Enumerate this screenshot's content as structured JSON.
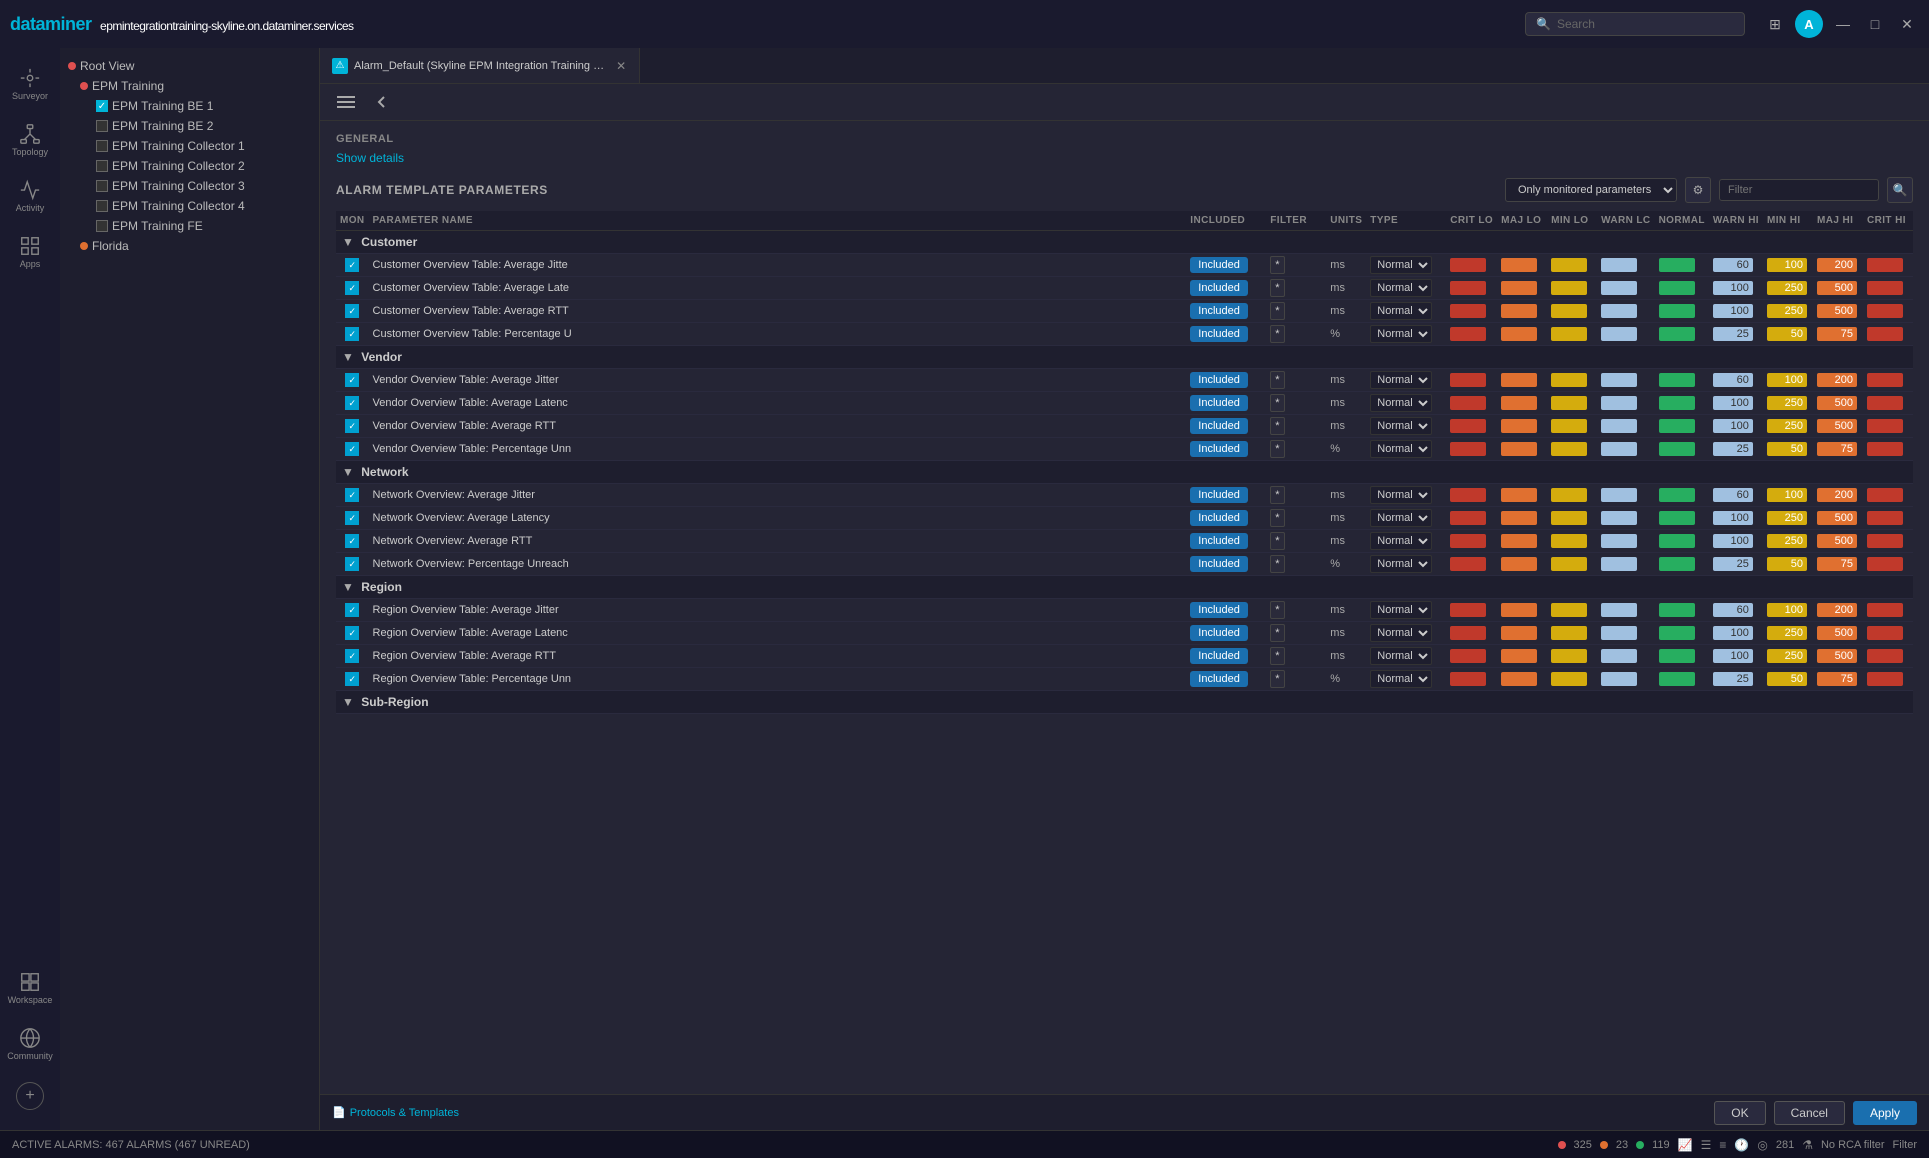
{
  "topbar": {
    "logo": "dataminer",
    "url": "epmintegrationtraining-skyline.on.dataminer.services",
    "search_placeholder": "Search",
    "avatar_letter": "A",
    "pin_icon": "⊞",
    "min_icon": "—",
    "max_icon": "□",
    "close_icon": "✕"
  },
  "sidebar_icons": [
    {
      "id": "surveyor",
      "label": "Surveyor"
    },
    {
      "id": "topology",
      "label": "Topology"
    },
    {
      "id": "activity",
      "label": "Activity"
    },
    {
      "id": "apps",
      "label": "Apps"
    },
    {
      "id": "workspace",
      "label": "Workspace"
    },
    {
      "id": "community",
      "label": "Community"
    }
  ],
  "tree": {
    "items": [
      {
        "id": "root",
        "label": "Root View",
        "level": 0,
        "type": "red-dot",
        "has_arrow": false
      },
      {
        "id": "epm-training",
        "label": "EPM Training",
        "level": 1,
        "type": "red-dot"
      },
      {
        "id": "be1",
        "label": "EPM Training BE 1",
        "level": 2,
        "type": "checkbox"
      },
      {
        "id": "be2",
        "label": "EPM Training BE 2",
        "level": 2,
        "type": "checkbox"
      },
      {
        "id": "col1",
        "label": "EPM Training Collector 1",
        "level": 2,
        "type": "checkbox"
      },
      {
        "id": "col2",
        "label": "EPM Training Collector 2",
        "level": 2,
        "type": "checkbox"
      },
      {
        "id": "col3",
        "label": "EPM Training Collector 3",
        "level": 2,
        "type": "checkbox"
      },
      {
        "id": "col4",
        "label": "EPM Training Collector 4",
        "level": 2,
        "type": "checkbox"
      },
      {
        "id": "fe",
        "label": "EPM Training FE",
        "level": 2,
        "type": "checkbox"
      },
      {
        "id": "florida",
        "label": "Florida",
        "level": 1,
        "type": "orange-dot"
      }
    ]
  },
  "tab": {
    "title": "Alarm_Default (Skyline EPM Integration Training Manager: Production)",
    "close_icon": "✕"
  },
  "general": {
    "label": "GENERAL",
    "show_details": "Show details"
  },
  "alarm_template": {
    "label": "ALARM TEMPLATE PARAMETERS",
    "monitored_select": "Only monitored parameters",
    "filter_placeholder": "Filter",
    "columns": {
      "mon": "MON",
      "param_name": "PARAMETER NAME",
      "included": "INCLUDED",
      "filter": "FILTER",
      "units": "UNITS",
      "type": "TYPE",
      "crit_lo": "CRIT LO",
      "maj_lo": "MAJ LO",
      "min_lo": "MIN LO",
      "warn_lc": "WARN LC",
      "normal": "NORMAL",
      "warn_hi": "WARN HI",
      "min_hi": "MIN HI",
      "maj_hi": "MAJ HI",
      "crit_hi": "CRIT HI"
    },
    "groups": [
      {
        "id": "customer",
        "label": "Customer",
        "rows": [
          {
            "param": "Customer Overview Table: Average Jitte",
            "included": "Included",
            "filter": "*",
            "units": "ms",
            "type": "Normal",
            "crit_lo": "",
            "maj_lo": "",
            "min_lo": "",
            "warn_lc": "",
            "normal": "",
            "warn_hi": "60",
            "min_hi": "100",
            "maj_hi": "200",
            "crit_hi": ""
          },
          {
            "param": "Customer Overview Table: Average Late",
            "included": "Included",
            "filter": "*",
            "units": "ms",
            "type": "Normal",
            "crit_lo": "",
            "maj_lo": "",
            "min_lo": "",
            "warn_lc": "",
            "normal": "",
            "warn_hi": "100",
            "min_hi": "250",
            "maj_hi": "500",
            "crit_hi": ""
          },
          {
            "param": "Customer Overview Table: Average RTT",
            "included": "Included",
            "filter": "*",
            "units": "ms",
            "type": "Normal",
            "crit_lo": "",
            "maj_lo": "",
            "min_lo": "",
            "warn_lc": "",
            "normal": "",
            "warn_hi": "100",
            "min_hi": "250",
            "maj_hi": "500",
            "crit_hi": ""
          },
          {
            "param": "Customer Overview Table: Percentage U",
            "included": "Included",
            "filter": "*",
            "units": "%",
            "type": "Normal",
            "crit_lo": "",
            "maj_lo": "",
            "min_lo": "",
            "warn_lc": "",
            "normal": "",
            "warn_hi": "25",
            "min_hi": "50",
            "maj_hi": "75",
            "crit_hi": ""
          }
        ]
      },
      {
        "id": "vendor",
        "label": "Vendor",
        "rows": [
          {
            "param": "Vendor Overview Table: Average Jitter",
            "included": "Included",
            "filter": "*",
            "units": "ms",
            "type": "Normal",
            "crit_lo": "",
            "maj_lo": "",
            "min_lo": "",
            "warn_lc": "",
            "normal": "",
            "warn_hi": "60",
            "min_hi": "100",
            "maj_hi": "200",
            "crit_hi": ""
          },
          {
            "param": "Vendor Overview Table: Average Latenc",
            "included": "Included",
            "filter": "*",
            "units": "ms",
            "type": "Normal",
            "crit_lo": "",
            "maj_lo": "",
            "min_lo": "",
            "warn_lc": "",
            "normal": "",
            "warn_hi": "100",
            "min_hi": "250",
            "maj_hi": "500",
            "crit_hi": ""
          },
          {
            "param": "Vendor Overview Table: Average RTT",
            "included": "Included",
            "filter": "*",
            "units": "ms",
            "type": "Normal",
            "crit_lo": "",
            "maj_lo": "",
            "min_lo": "",
            "warn_lc": "",
            "normal": "",
            "warn_hi": "100",
            "min_hi": "250",
            "maj_hi": "500",
            "crit_hi": ""
          },
          {
            "param": "Vendor Overview Table: Percentage Unn",
            "included": "Included",
            "filter": "*",
            "units": "%",
            "type": "Normal",
            "crit_lo": "",
            "maj_lo": "",
            "min_lo": "",
            "warn_lc": "",
            "normal": "",
            "warn_hi": "25",
            "min_hi": "50",
            "maj_hi": "75",
            "crit_hi": ""
          }
        ]
      },
      {
        "id": "network",
        "label": "Network",
        "rows": [
          {
            "param": "Network Overview: Average Jitter",
            "included": "Included",
            "filter": "*",
            "units": "ms",
            "type": "Normal",
            "crit_lo": "",
            "maj_lo": "",
            "min_lo": "",
            "warn_lc": "",
            "normal": "",
            "warn_hi": "60",
            "min_hi": "100",
            "maj_hi": "200",
            "crit_hi": ""
          },
          {
            "param": "Network Overview: Average Latency",
            "included": "Included",
            "filter": "*",
            "units": "ms",
            "type": "Normal",
            "crit_lo": "",
            "maj_lo": "",
            "min_lo": "",
            "warn_lc": "",
            "normal": "",
            "warn_hi": "100",
            "min_hi": "250",
            "maj_hi": "500",
            "crit_hi": ""
          },
          {
            "param": "Network Overview: Average RTT",
            "included": "Included",
            "filter": "*",
            "units": "ms",
            "type": "Normal",
            "crit_lo": "",
            "maj_lo": "",
            "min_lo": "",
            "warn_lc": "",
            "normal": "",
            "warn_hi": "100",
            "min_hi": "250",
            "maj_hi": "500",
            "crit_hi": ""
          },
          {
            "param": "Network Overview: Percentage Unreach",
            "included": "Included",
            "filter": "*",
            "units": "%",
            "type": "Normal",
            "crit_lo": "",
            "maj_lo": "",
            "min_lo": "",
            "warn_lc": "",
            "normal": "",
            "warn_hi": "25",
            "min_hi": "50",
            "maj_hi": "75",
            "crit_hi": ""
          }
        ]
      },
      {
        "id": "region",
        "label": "Region",
        "rows": [
          {
            "param": "Region Overview Table: Average Jitter",
            "included": "Included",
            "filter": "*",
            "units": "ms",
            "type": "Normal",
            "crit_lo": "",
            "maj_lo": "",
            "min_lo": "",
            "warn_lc": "",
            "normal": "",
            "warn_hi": "60",
            "min_hi": "100",
            "maj_hi": "200",
            "crit_hi": ""
          },
          {
            "param": "Region Overview Table: Average Latenc",
            "included": "Included",
            "filter": "*",
            "units": "ms",
            "type": "Normal",
            "crit_lo": "",
            "maj_lo": "",
            "min_lo": "",
            "warn_lc": "",
            "normal": "",
            "warn_hi": "100",
            "min_hi": "250",
            "maj_hi": "500",
            "crit_hi": ""
          },
          {
            "param": "Region Overview Table: Average RTT",
            "included": "Included",
            "filter": "*",
            "units": "ms",
            "type": "Normal",
            "crit_lo": "",
            "maj_lo": "",
            "min_lo": "",
            "warn_lc": "",
            "normal": "",
            "warn_hi": "100",
            "min_hi": "250",
            "maj_hi": "500",
            "crit_hi": ""
          },
          {
            "param": "Region Overview Table: Percentage Unn",
            "included": "Included",
            "filter": "*",
            "units": "%",
            "type": "Normal",
            "crit_lo": "",
            "maj_lo": "",
            "min_lo": "",
            "warn_lc": "",
            "normal": "",
            "warn_hi": "25",
            "min_hi": "50",
            "maj_hi": "75",
            "crit_hi": ""
          }
        ]
      },
      {
        "id": "subregion",
        "label": "Sub-Region",
        "rows": []
      }
    ]
  },
  "bottom": {
    "breadcrumb_icon": "📄",
    "breadcrumb_label": "Protocols & Templates",
    "ok_label": "OK",
    "cancel_label": "Cancel",
    "apply_label": "Apply"
  },
  "statusbar": {
    "alarm_text": "ACTIVE ALARMS: 467 ALARMS (467 UNREAD)",
    "count_red": "325",
    "count_orange": "23",
    "count_green": "119",
    "dma_count": "281",
    "filter_label": "No RCA filter",
    "filter_text": "Filter"
  },
  "colors": {
    "crit": "#c0392b",
    "maj": "#e07030",
    "min": "#d4ac0d",
    "warn": "#a0c0e0",
    "normal": "#27ae60",
    "included": "#1a6faf",
    "accent": "#00b4d8"
  }
}
